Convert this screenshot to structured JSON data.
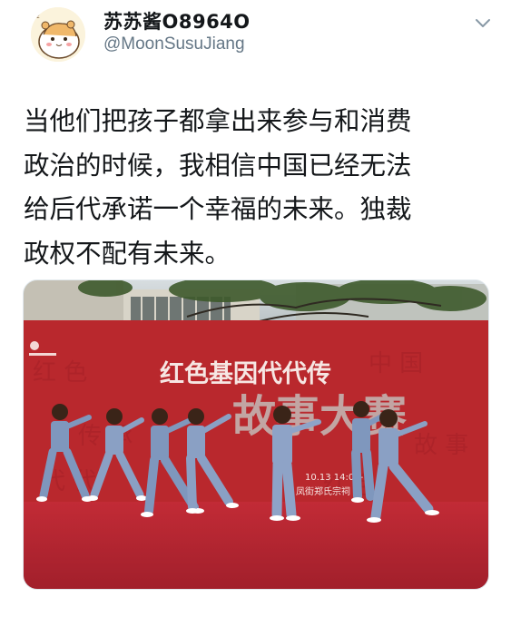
{
  "tweet": {
    "display_name": "苏苏酱O8964O",
    "handle": "@MoonSusuJiang",
    "text_lines": [
      "当他们把孩子都拿出来参与和消费",
      "政治的时候，我相信中国已经无法",
      "给后代承诺一个幸福的未来。独裁",
      "政权不配有未来。"
    ],
    "menu_icon": "chevron-down-icon"
  },
  "photo": {
    "banner_line1": "红色基因代代传",
    "banner_line2": "故事大赛",
    "banner_date": "10.13 14:00-1",
    "banner_venue": "凤街郑氏宗祠"
  },
  "colors": {
    "text": "#14171a",
    "secondary": "#657786",
    "banner_red": "#b9282d",
    "stage_red": "#c8303a"
  }
}
